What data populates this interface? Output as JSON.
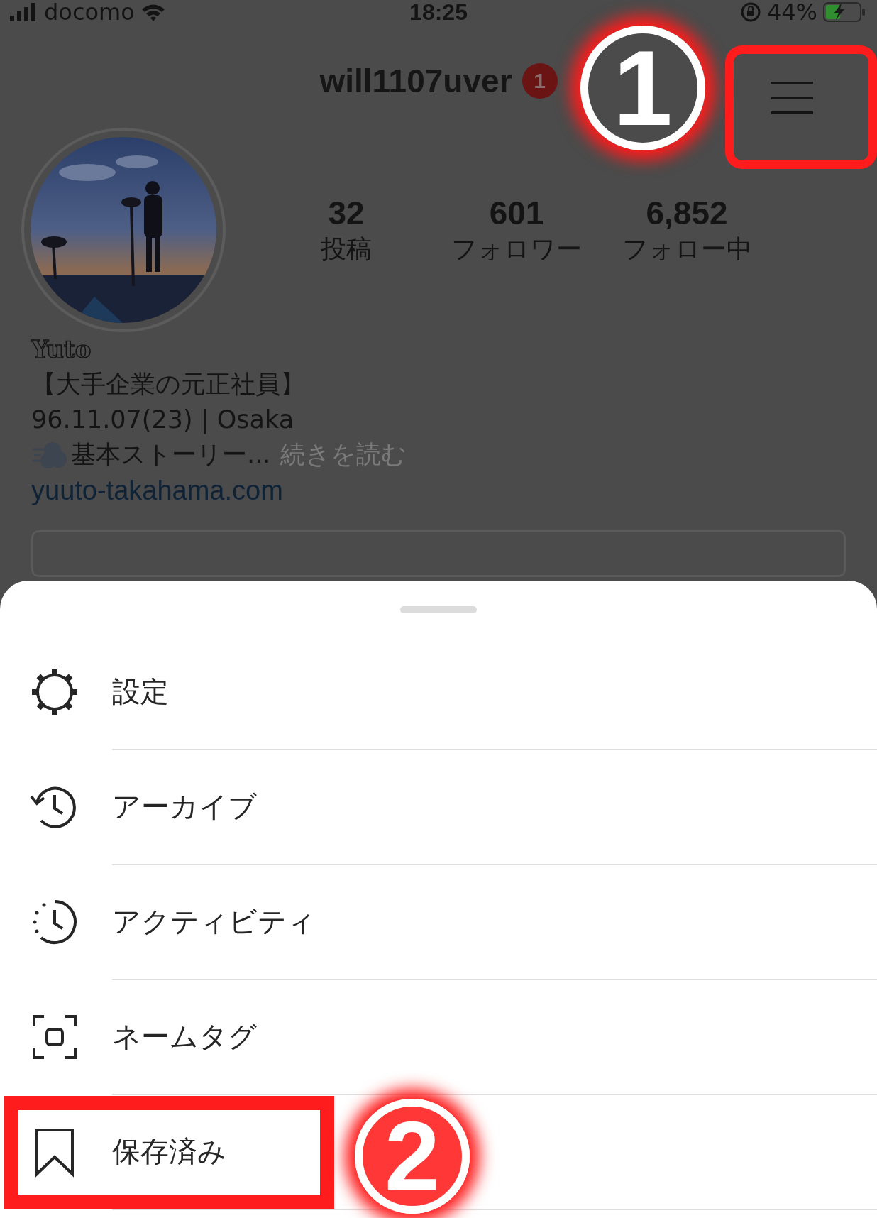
{
  "status_bar": {
    "carrier": "docomo",
    "time": "18:25",
    "battery": "44%",
    "charging": true
  },
  "header": {
    "username": "will1107uver",
    "notification_badge": "1",
    "menu_button": {
      "highlighted": true
    }
  },
  "profile": {
    "avatar": {
      "kind": "picture"
    },
    "stats": [
      {
        "value": "32",
        "label": "投稿"
      },
      {
        "value": "601",
        "label": "フォロワー"
      },
      {
        "value": "6,852",
        "label": "フォロー中"
      }
    ],
    "name": "Yuto",
    "bio": [
      "【大手企業の元正社員】",
      "96.11.07(23) | Osaka"
    ],
    "story_line": {
      "text": "基本ストーリー...",
      "more": "続きを読む"
    },
    "link": "yuuto-takahama.com"
  },
  "menu": {
    "items": [
      {
        "kind": "settings",
        "label": "設定",
        "highlighted": false
      },
      {
        "kind": "archive",
        "label": "アーカイブ",
        "highlighted": false
      },
      {
        "kind": "activity",
        "label": "アクティビティ",
        "highlighted": false
      },
      {
        "kind": "nametag",
        "label": "ネームタグ",
        "highlighted": false
      },
      {
        "kind": "saved",
        "label": "保存済み",
        "highlighted": true
      }
    ]
  },
  "annotations": [
    {
      "label": "1"
    },
    {
      "label": "2"
    }
  ]
}
